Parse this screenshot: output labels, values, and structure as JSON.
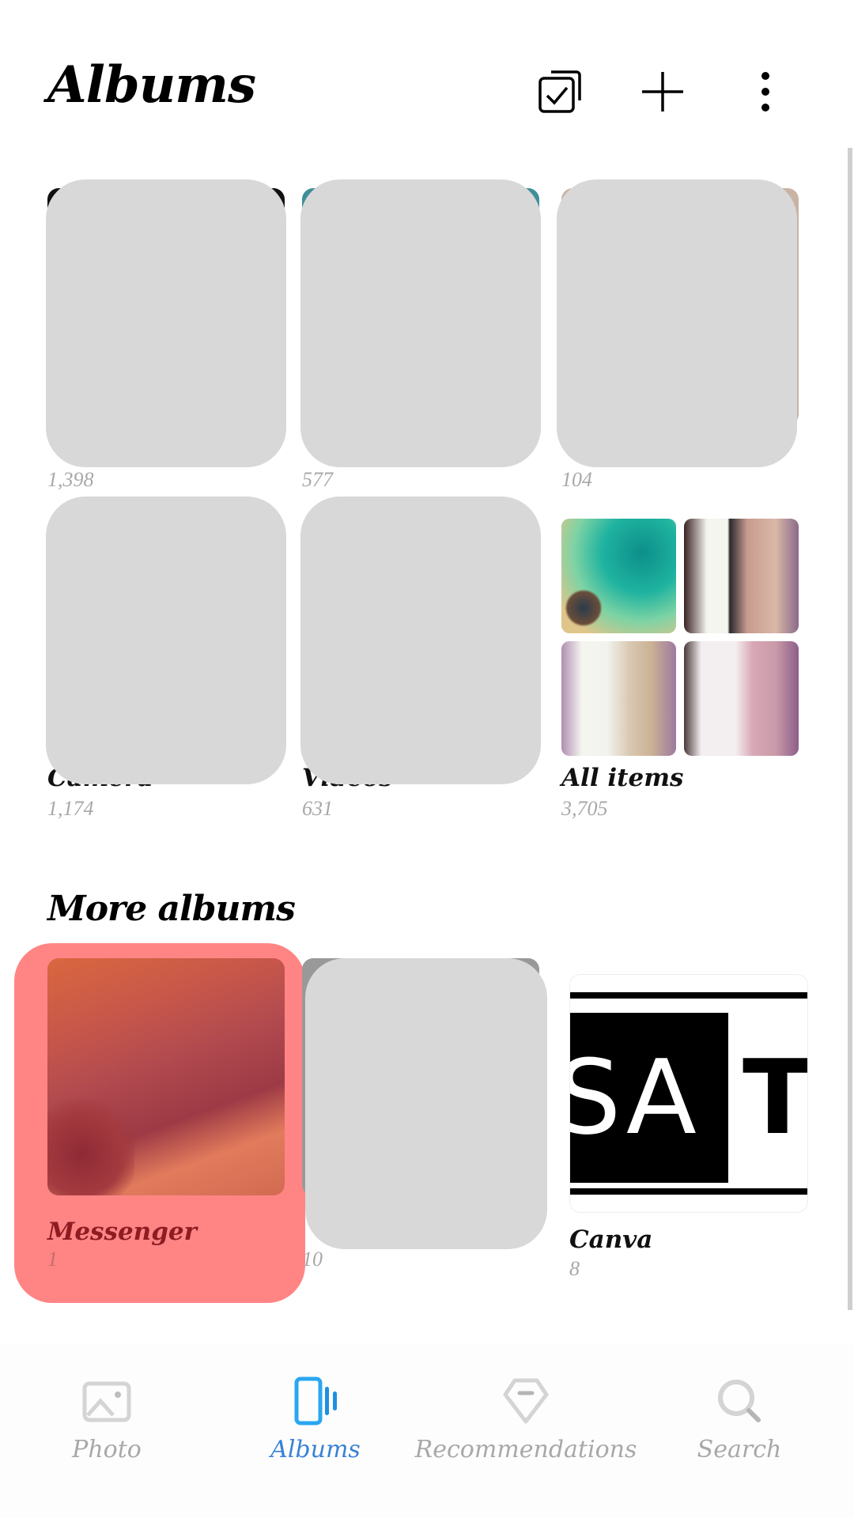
{
  "header": {
    "title": "Albums",
    "actions": [
      "select-icon",
      "add-icon",
      "more-icon"
    ]
  },
  "albums": [
    {
      "name": "",
      "count": "1,398",
      "redacted": true
    },
    {
      "name": "",
      "count": "577",
      "redacted": true
    },
    {
      "name": "",
      "count": "104",
      "redacted": true
    },
    {
      "name": "Camera",
      "count": "1,174",
      "redacted": true
    },
    {
      "name": "Videos",
      "count": "631",
      "redacted": true
    },
    {
      "name": "All items",
      "count": "3,705",
      "redacted": false
    }
  ],
  "more_albums": {
    "title": "More albums",
    "items": [
      {
        "name": "Messenger",
        "count": "1",
        "highlighted": true
      },
      {
        "name": "",
        "count": "10",
        "redacted": true
      },
      {
        "name": "Canva",
        "count": "8"
      }
    ]
  },
  "canva_thumb": {
    "text_inverse": "SA",
    "text": "T"
  },
  "bottom_nav": {
    "items": [
      {
        "label": "Photo",
        "icon": "photo-icon",
        "active": false
      },
      {
        "label": "Albums",
        "icon": "albums-icon",
        "active": true
      },
      {
        "label": "Recommendations",
        "icon": "diamond-icon",
        "active": false
      },
      {
        "label": "Search",
        "icon": "search-icon",
        "active": false
      }
    ]
  },
  "colors": {
    "accent": "#3a82d6",
    "icon_active": "#2aa7f0",
    "inactive": "#a8a8a8",
    "highlight": "#ff8585",
    "redaction": "#d8d8d8"
  }
}
